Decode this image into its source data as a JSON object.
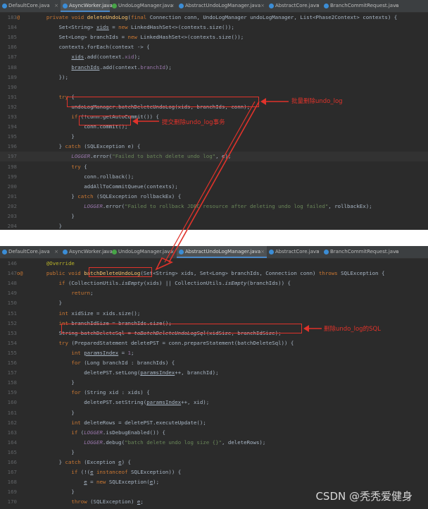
{
  "top_tabs": [
    {
      "label": "DefaultCore.java",
      "color": "#3b8dd6",
      "active": false
    },
    {
      "label": "AsyncWorker.java",
      "color": "#3b8dd6",
      "active": true
    },
    {
      "label": "UndoLogManager.java",
      "color": "#47a447",
      "active": false
    },
    {
      "label": "AbstractUndoLogManager.java",
      "color": "#3b8dd6",
      "active": false
    },
    {
      "label": "AbstractCore.java",
      "color": "#3b8dd6",
      "active": false
    },
    {
      "label": "BranchCommitRequest.java",
      "color": "#3b8dd6",
      "active": false
    }
  ],
  "bottom_tabs": [
    {
      "label": "DefaultCore.java",
      "color": "#3b8dd6",
      "active": false
    },
    {
      "label": "AsyncWorker.java",
      "color": "#3b8dd6",
      "active": false
    },
    {
      "label": "UndoLogManager.java",
      "color": "#47a447",
      "active": false
    },
    {
      "label": "AbstractUndoLogManager.java",
      "color": "#3b8dd6",
      "active": true
    },
    {
      "label": "AbstractCore.java",
      "color": "#3b8dd6",
      "active": false
    },
    {
      "label": "BranchCommitRequest.java",
      "color": "#3b8dd6",
      "active": false
    }
  ],
  "top_code": [
    {
      "n": "183",
      "g": "@",
      "html": "    <span class='k'>private void </span><span class='m'>deleteUndoLog</span>(<span class='k'>final </span>Connection conn, UndoLogManager undoLogManager, List&lt;Phase2Context&gt; contexts) {"
    },
    {
      "n": "184",
      "g": "",
      "html": "        Set&lt;String&gt; <span class='u'>xids</span> = <span class='k'>new </span>LinkedHashSet&lt;&gt;(contexts.size());"
    },
    {
      "n": "185",
      "g": "",
      "html": "        Set&lt;Long&gt; branchIds = <span class='k'>new </span>LinkedHashSet&lt;&gt;(contexts.size());"
    },
    {
      "n": "186",
      "g": "",
      "html": "        contexts.forEach(context -&gt; {"
    },
    {
      "n": "187",
      "g": "",
      "html": "            <span class='u'>xids</span>.add(context.<span class='f'>xid</span>);"
    },
    {
      "n": "188",
      "g": "",
      "html": "            <span class='u'>branchIds</span>.add(context.<span class='f'>branchId</span>);"
    },
    {
      "n": "189",
      "g": "",
      "html": "        });"
    },
    {
      "n": "190",
      "g": "",
      "html": ""
    },
    {
      "n": "191",
      "g": "",
      "html": "        <span class='k'>try </span>{"
    },
    {
      "n": "192",
      "g": "",
      "html": "            undoLogManager.batchDeleteUndoLog(xids, branchIds, conn);"
    },
    {
      "n": "193",
      "g": "",
      "html": "            <span class='k'>if </span>(!conn.getAutoCommit()) {"
    },
    {
      "n": "194",
      "g": "",
      "html": "                conn.commit();"
    },
    {
      "n": "195",
      "g": "",
      "html": "            }"
    },
    {
      "n": "196",
      "g": "",
      "html": "        } <span class='k'>catch </span>(SQLException e) {"
    },
    {
      "n": "197",
      "g": "",
      "html": "            <span class='f i'>LOGGER</span>.error(<span class='s'>\"Failed to batch delete undo log\"</span>, e);",
      "hl": true
    },
    {
      "n": "198",
      "g": "",
      "html": "            <span class='k'>try </span>{"
    },
    {
      "n": "199",
      "g": "",
      "html": "                conn.rollback();"
    },
    {
      "n": "200",
      "g": "",
      "html": "                addAllToCommitQueue(contexts);"
    },
    {
      "n": "201",
      "g": "",
      "html": "            } <span class='k'>catch </span>(SQLException rollbackEx) {"
    },
    {
      "n": "202",
      "g": "",
      "html": "                <span class='f i'>LOGGER</span>.error(<span class='s'>\"Failed to rollback JDBC resource after deleting undo log failed\"</span>, rollbackEx);"
    },
    {
      "n": "203",
      "g": "",
      "html": "            }"
    },
    {
      "n": "204",
      "g": "",
      "html": "        }"
    },
    {
      "n": "205",
      "g": "",
      "html": "    }"
    }
  ],
  "bottom_code": [
    {
      "n": "146",
      "g": "",
      "html": "    <span class='an'>@Override</span>"
    },
    {
      "n": "147",
      "g": "o@",
      "html": "    <span class='k'>public void </span><span class='m'>batchDeleteUndoLog</span>(Set&lt;String&gt; xids, Set&lt;Long&gt; branchIds, Connection conn) <span class='k'>throws </span>SQLException {"
    },
    {
      "n": "148",
      "g": "",
      "html": "        <span class='k'>if </span>(CollectionUtils.<span class='i'>isEmpty</span>(xids) || CollectionUtils.<span class='i'>isEmpty</span>(branchIds)) {"
    },
    {
      "n": "149",
      "g": "",
      "html": "            <span class='k'>return</span>;"
    },
    {
      "n": "150",
      "g": "",
      "html": "        }"
    },
    {
      "n": "151",
      "g": "",
      "html": "        <span class='k'>int </span>xidSize = xids.size();"
    },
    {
      "n": "152",
      "g": "",
      "html": "        <span class='k'>int </span>branchIdSize = branchIds.size();"
    },
    {
      "n": "153",
      "g": "",
      "html": "        String batchDeleteSql = <span class='i'>toBatchDeleteUndoLogSql</span>(xidSize, branchIdSize);"
    },
    {
      "n": "154",
      "g": "",
      "html": "        <span class='k'>try </span>(PreparedStatement deletePST = conn.prepareStatement(batchDeleteSql)) {"
    },
    {
      "n": "155",
      "g": "",
      "html": "            <span class='k'>int </span><span class='u'>paramsIndex</span> = <span class='f'>1</span>;"
    },
    {
      "n": "156",
      "g": "",
      "html": "            <span class='k'>for </span>(Long branchId : branchIds) {"
    },
    {
      "n": "157",
      "g": "",
      "html": "                deletePST.setLong(<span class='u'>paramsIndex</span>++, branchId);"
    },
    {
      "n": "158",
      "g": "",
      "html": "            }"
    },
    {
      "n": "159",
      "g": "",
      "html": "            <span class='k'>for </span>(String xid : xids) {"
    },
    {
      "n": "160",
      "g": "",
      "html": "                deletePST.setString(<span class='u'>paramsIndex</span>++, xid);"
    },
    {
      "n": "161",
      "g": "",
      "html": "            }"
    },
    {
      "n": "162",
      "g": "",
      "html": "            <span class='k'>int </span>deleteRows = deletePST.executeUpdate();"
    },
    {
      "n": "163",
      "g": "",
      "html": "            <span class='k'>if </span>(<span class='f i'>LOGGER</span>.isDebugEnabled()) {"
    },
    {
      "n": "164",
      "g": "",
      "html": "                <span class='f i'>LOGGER</span>.debug(<span class='s'>\"batch delete undo log size {}\"</span>, deleteRows);"
    },
    {
      "n": "165",
      "g": "",
      "html": "            }"
    },
    {
      "n": "166",
      "g": "",
      "html": "        } <span class='k'>catch </span>(Exception <span class='u'>e</span>) {"
    },
    {
      "n": "167",
      "g": "",
      "html": "            <span class='k'>if </span>(!(<span class='u'>e</span> <span class='k'>instanceof </span>SQLException)) {"
    },
    {
      "n": "168",
      "g": "",
      "html": "                <span class='u'>e</span> = <span class='k'>new </span>SQLException(<span class='u'>e</span>);"
    },
    {
      "n": "169",
      "g": "",
      "html": "            }"
    },
    {
      "n": "170",
      "g": "",
      "html": "            <span class='k'>throw </span>(SQLException) <span class='u'>e</span>;"
    },
    {
      "n": "171",
      "g": "",
      "html": "        }"
    },
    {
      "n": "172",
      "g": "",
      "html": "    }"
    }
  ],
  "annotations": {
    "batch_delete": "批量删除undo_log",
    "commit": "提交删除undo_log事务",
    "delete_sql": "删除undo_log的SQL"
  },
  "accent_color": "#e0332b",
  "watermark": "CSDN @秃秃爱健身"
}
